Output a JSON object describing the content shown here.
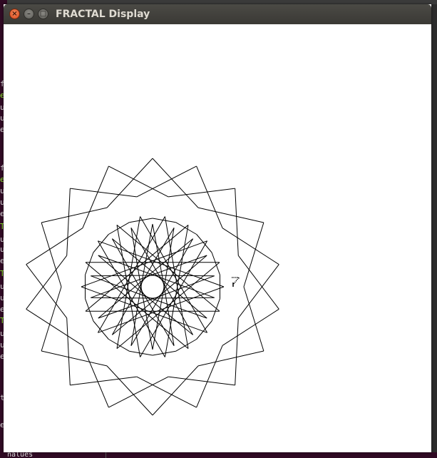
{
  "window": {
    "title": "FRACTAL Display",
    "close_glyph": "×",
    "minimize_glyph": "–",
    "maximize_glyph": "□"
  },
  "background_terminal": {
    "left_glyphs": [
      {
        "text": "f",
        "color": "#dddddd"
      },
      {
        "text": "e",
        "color": "#8ae234"
      },
      {
        "text": "u",
        "color": "#dddddd"
      },
      {
        "text": "u",
        "color": "#dddddd"
      },
      {
        "text": "e",
        "color": "#dddddd"
      },
      {
        "text": "f",
        "color": "#dddddd"
      },
      {
        "text": "e",
        "color": "#8ae234"
      },
      {
        "text": "u",
        "color": "#dddddd"
      },
      {
        "text": "u",
        "color": "#dddddd"
      },
      {
        "text": "e",
        "color": "#dddddd"
      },
      {
        "text": "T",
        "color": "#8ae234"
      },
      {
        "text": "u",
        "color": "#dddddd"
      },
      {
        "text": "u",
        "color": "#dddddd"
      },
      {
        "text": "e",
        "color": "#dddddd"
      },
      {
        "text": "T",
        "color": "#8ae234"
      },
      {
        "text": "u",
        "color": "#dddddd"
      },
      {
        "text": "u",
        "color": "#dddddd"
      },
      {
        "text": "e",
        "color": "#dddddd"
      },
      {
        "text": "T",
        "color": "#8ae234"
      },
      {
        "text": "u",
        "color": "#dddddd"
      },
      {
        "text": "u",
        "color": "#dddddd"
      },
      {
        "text": "e",
        "color": "#dddddd"
      },
      {
        "text": "t",
        "color": "#dddddd"
      },
      {
        "text": "e",
        "color": "#dddddd"
      }
    ],
    "bottom_text": "nalues"
  },
  "fractal": {
    "stroke_color": "#000000",
    "background": "#ffffff",
    "star_points": 18,
    "star_skip": 7
  },
  "icons": {
    "cursor": "mouse-pointer-icon"
  }
}
